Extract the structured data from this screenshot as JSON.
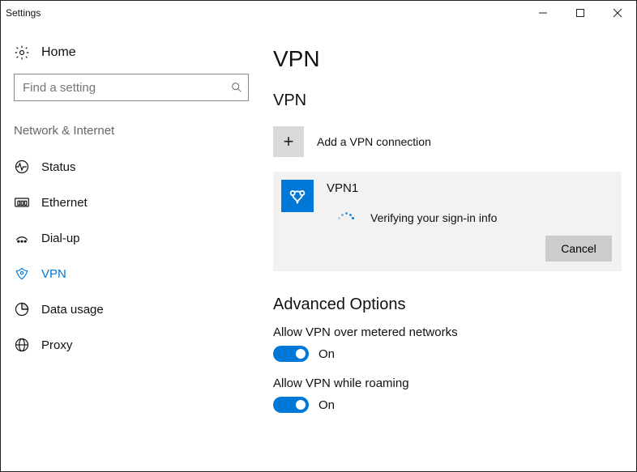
{
  "window": {
    "title": "Settings"
  },
  "sidebar": {
    "home_label": "Home",
    "search_placeholder": "Find a setting",
    "group_heading": "Network & Internet",
    "items": [
      {
        "label": "Status"
      },
      {
        "label": "Ethernet"
      },
      {
        "label": "Dial-up"
      },
      {
        "label": "VPN"
      },
      {
        "label": "Data usage"
      },
      {
        "label": "Proxy"
      }
    ]
  },
  "main": {
    "page_title": "VPN",
    "section_heading": "VPN",
    "add_label": "Add a VPN connection",
    "connection": {
      "name": "VPN1",
      "status": "Verifying your sign-in info",
      "cancel_label": "Cancel"
    },
    "advanced": {
      "heading": "Advanced Options",
      "toggles": [
        {
          "label": "Allow VPN over metered networks",
          "state": "On"
        },
        {
          "label": "Allow VPN while roaming",
          "state": "On"
        }
      ]
    }
  }
}
